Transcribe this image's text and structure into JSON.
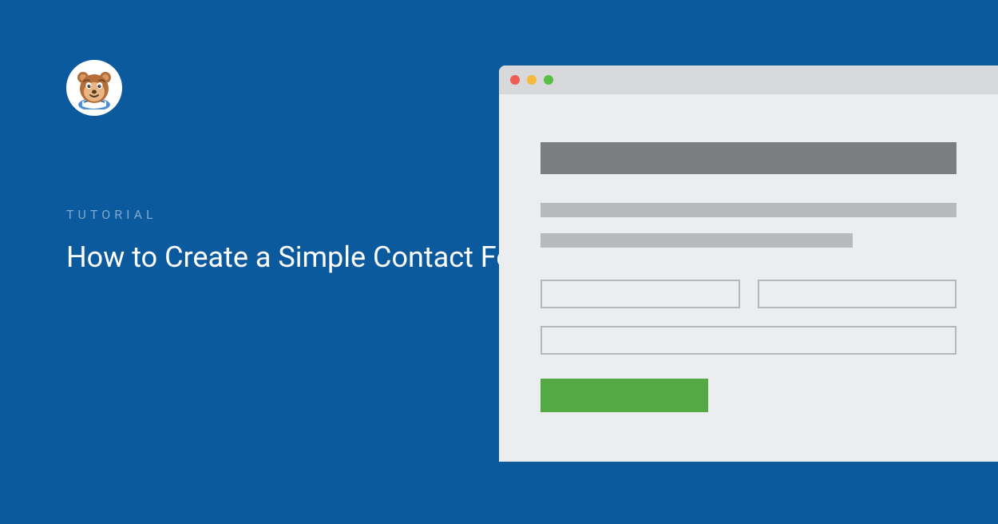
{
  "category": "TUTORIAL",
  "title": "How to Create a Simple Contact Form in WordPress",
  "colors": {
    "background": "#0c5a9e",
    "button": "#54a945",
    "window_bg": "#ecedee",
    "titlebar_bg": "#d6d8d9"
  },
  "traffic_lights": {
    "red": "#f05b52",
    "yellow": "#f6bb3d",
    "green": "#55c041"
  }
}
